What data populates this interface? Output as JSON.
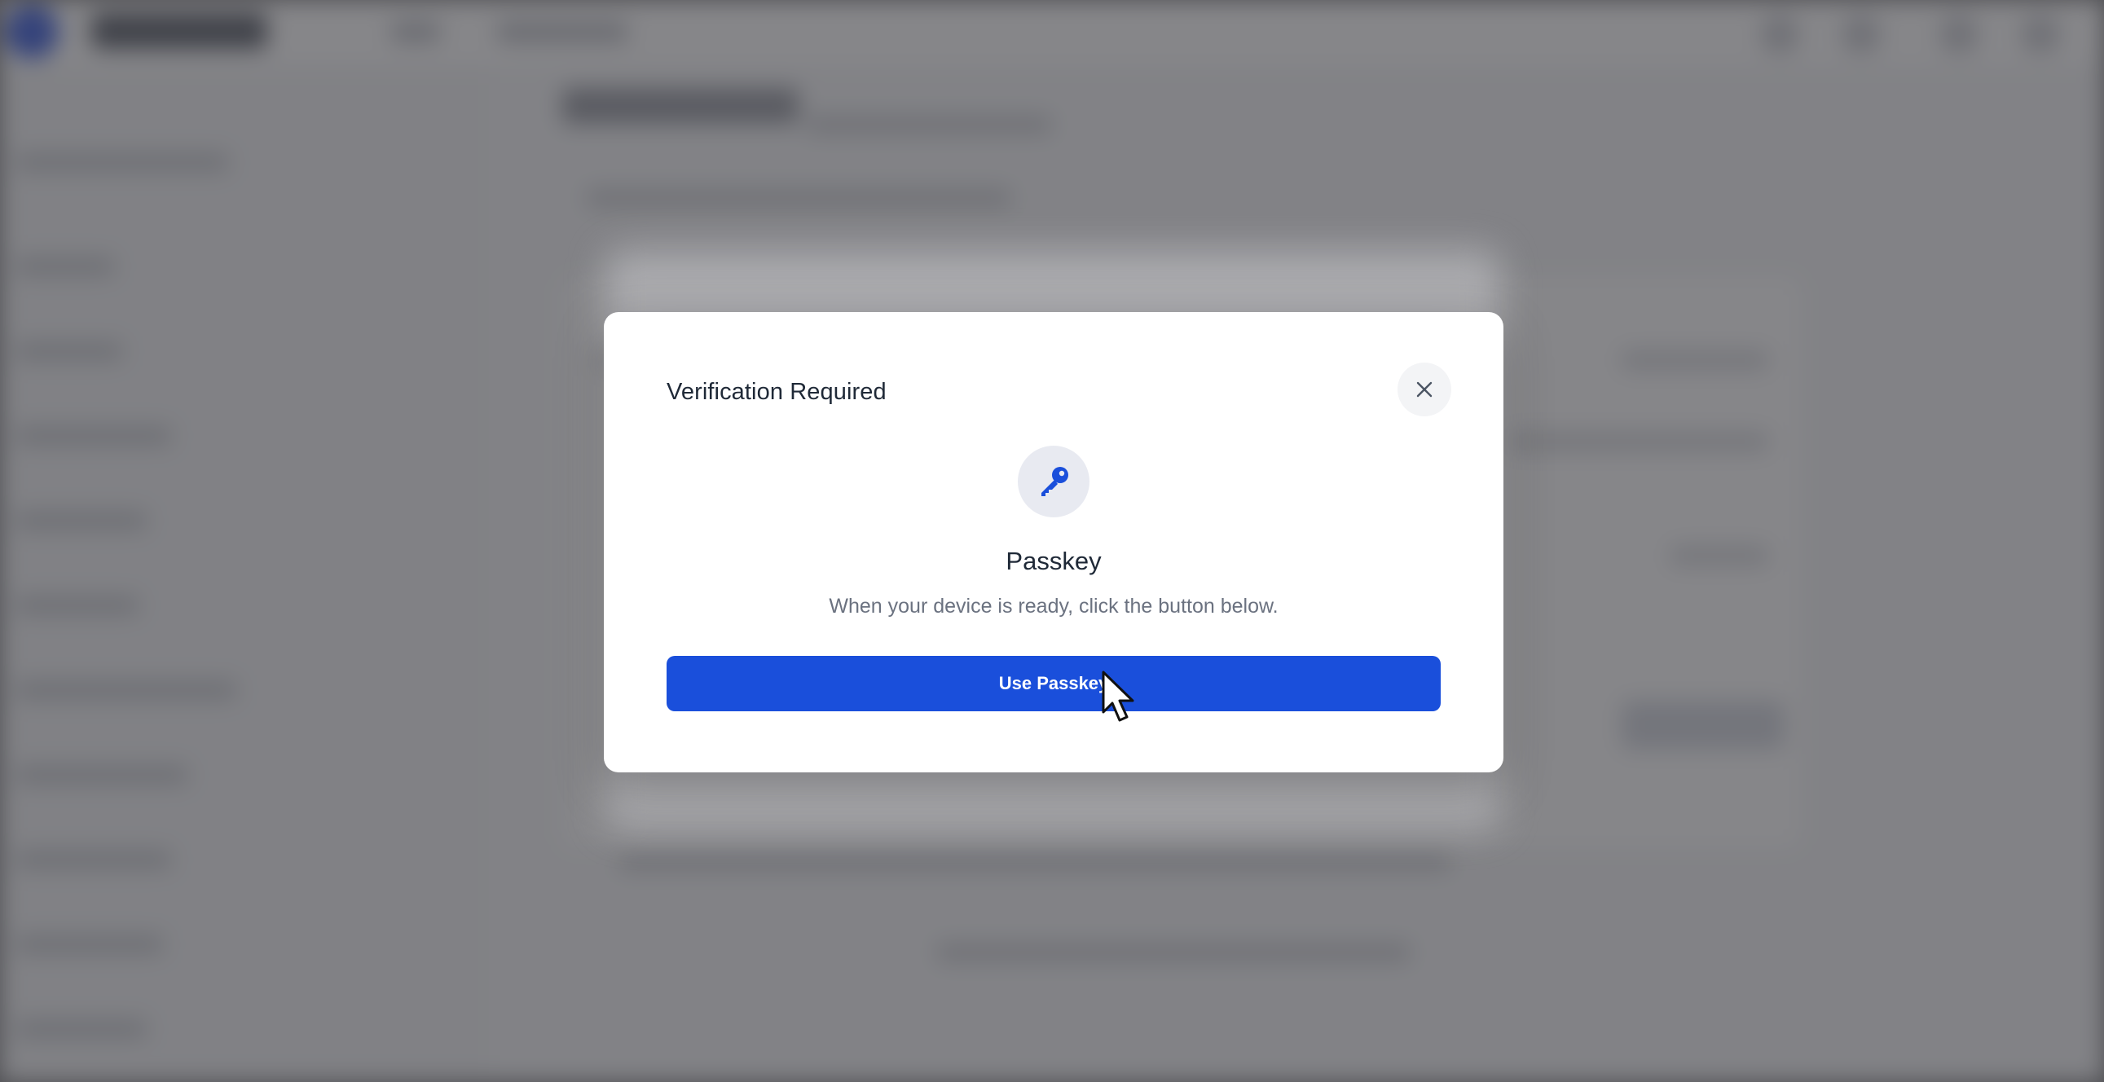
{
  "colors": {
    "accent": "#1a4fdb",
    "modal_background": "#ffffff",
    "title_text": "#1f2937",
    "secondary_text": "#6b7280",
    "icon_badge_background": "#e8eaf1"
  },
  "dialog": {
    "title": "Verification Required",
    "close_icon": "close-icon",
    "method_icon": "key-icon",
    "method_title": "Passkey",
    "method_description": "When your device is ready, click the button below.",
    "primary_button_label": "Use Passkey"
  },
  "cursor": {
    "icon": "mouse-pointer-icon"
  }
}
